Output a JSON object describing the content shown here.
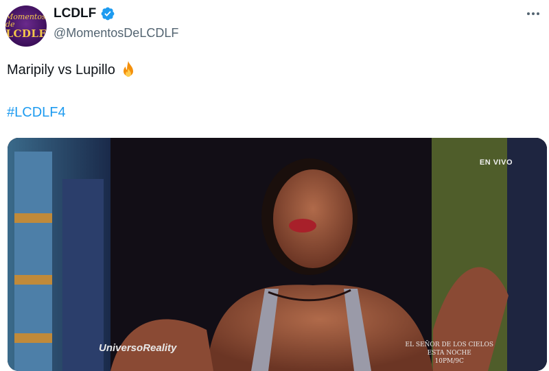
{
  "account": {
    "display_name": "LCDLF",
    "handle": "@MomentosDeLCDLF",
    "avatar_text_top": "Momentos de",
    "avatar_text_bottom": "LCDLF",
    "verified_icon": "verified-badge-icon"
  },
  "tweet": {
    "text": "Maripily vs Lupillo",
    "emoji_icon": "fire-emoji-icon",
    "hashtag": "#LCDLF4"
  },
  "media": {
    "live_label": "EN VIVO",
    "watermark": "UniversoReality",
    "promo_line1": "EL SEÑOR DE LOS CIELOS",
    "promo_line2": "ESTA NOCHE",
    "promo_line3": "10PM/9C"
  },
  "colors": {
    "link": "#1d9bf0",
    "verified": "#1d9bf0",
    "secondary_text": "#536471"
  }
}
